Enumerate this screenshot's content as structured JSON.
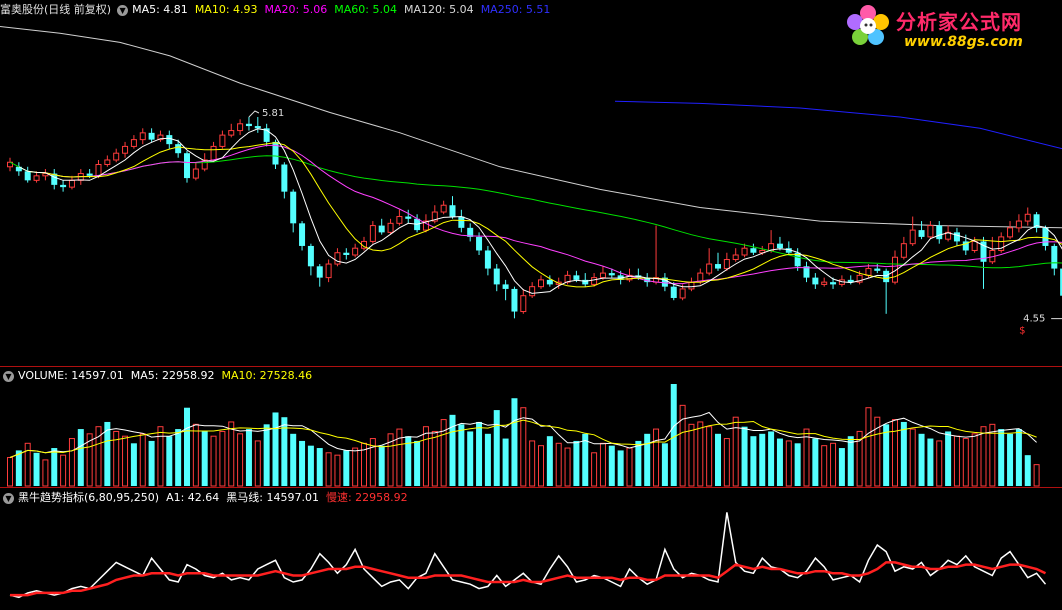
{
  "main_legend": {
    "title": "富奥股份(日线 前复权)",
    "items": [
      {
        "text": "MA5: 4.81",
        "color": "#ffffff"
      },
      {
        "text": "MA10: 4.93",
        "color": "#ffff00"
      },
      {
        "text": "MA20: 5.06",
        "color": "#ff00ff"
      },
      {
        "text": "MA60: 5.04",
        "color": "#00ff00"
      },
      {
        "text": "MA120: 5.04",
        "color": "#d8d8d8"
      },
      {
        "text": "MA250: 5.51",
        "color": "#3030ff"
      }
    ]
  },
  "vol_legend": {
    "items": [
      {
        "text": "VOLUME: 14597.01",
        "color": "#ffffff"
      },
      {
        "text": "MA5: 22958.92",
        "color": "#ffffff"
      },
      {
        "text": "MA10: 27528.46",
        "color": "#ffff00"
      }
    ]
  },
  "ind_legend": {
    "items": [
      {
        "text": "黑牛趋势指标(6,80,95,250)",
        "color": "#ffffff"
      },
      {
        "text": "A1: 42.64",
        "color": "#ffffff"
      },
      {
        "text": "黑马线: 14597.01",
        "color": "#ffffff"
      },
      {
        "text": "慢速: 22958.92",
        "color": "#ff3030"
      }
    ]
  },
  "logo": {
    "line1": "分析家公式网",
    "line2": "www.88gs.com"
  },
  "chart_data": {
    "type": "candlestick",
    "price_range": [
      4.5,
      5.95
    ],
    "high_annotation": "5.81",
    "low_annotation": "4.55",
    "marker": "$",
    "colors": {
      "up": "#ff3c3c",
      "down": "#54ffff",
      "ma5": "#ffffff",
      "ma10": "#ffff00",
      "ma20": "#ff40ff",
      "ma60": "#00e000",
      "ma120": "#d0d0d0",
      "ma250": "#2020ff",
      "slow": "#ff2020"
    },
    "candles": [
      [
        5.31,
        5.33,
        5.29,
        5.35
      ],
      [
        5.31,
        5.29,
        5.27,
        5.33
      ],
      [
        5.29,
        5.25,
        5.24,
        5.31
      ],
      [
        5.25,
        5.27,
        5.24,
        5.29
      ],
      [
        5.27,
        5.28,
        5.25,
        5.3
      ],
      [
        5.28,
        5.23,
        5.21,
        5.3
      ],
      [
        5.23,
        5.22,
        5.2,
        5.25
      ],
      [
        5.22,
        5.25,
        5.21,
        5.27
      ],
      [
        5.25,
        5.28,
        5.23,
        5.3
      ],
      [
        5.28,
        5.27,
        5.26,
        5.3
      ],
      [
        5.27,
        5.32,
        5.26,
        5.34
      ],
      [
        5.32,
        5.34,
        5.31,
        5.36
      ],
      [
        5.34,
        5.37,
        5.33,
        5.39
      ],
      [
        5.37,
        5.4,
        5.35,
        5.42
      ],
      [
        5.4,
        5.43,
        5.39,
        5.45
      ],
      [
        5.43,
        5.46,
        5.41,
        5.48
      ],
      [
        5.46,
        5.43,
        5.42,
        5.48
      ],
      [
        5.43,
        5.45,
        5.42,
        5.47
      ],
      [
        5.45,
        5.41,
        5.39,
        5.47
      ],
      [
        5.41,
        5.37,
        5.35,
        5.43
      ],
      [
        5.37,
        5.26,
        5.24,
        5.38
      ],
      [
        5.26,
        5.3,
        5.25,
        5.33
      ],
      [
        5.3,
        5.34,
        5.29,
        5.37
      ],
      [
        5.34,
        5.4,
        5.33,
        5.42
      ],
      [
        5.4,
        5.45,
        5.39,
        5.47
      ],
      [
        5.45,
        5.47,
        5.44,
        5.5
      ],
      [
        5.47,
        5.5,
        5.45,
        5.52
      ],
      [
        5.5,
        5.49,
        5.47,
        5.53
      ],
      [
        5.49,
        5.48,
        5.46,
        5.53
      ],
      [
        5.48,
        5.42,
        5.4,
        5.5
      ],
      [
        5.42,
        5.32,
        5.3,
        5.43
      ],
      [
        5.32,
        5.2,
        5.17,
        5.33
      ],
      [
        5.2,
        5.06,
        5.02,
        5.21
      ],
      [
        5.06,
        4.96,
        4.94,
        5.07
      ],
      [
        4.96,
        4.87,
        4.83,
        4.97
      ],
      [
        4.87,
        4.82,
        4.78,
        4.88
      ],
      [
        4.82,
        4.88,
        4.8,
        4.9
      ],
      [
        4.88,
        4.93,
        4.87,
        4.95
      ],
      [
        4.93,
        4.92,
        4.9,
        4.95
      ],
      [
        4.92,
        4.95,
        4.91,
        4.97
      ],
      [
        4.95,
        4.98,
        4.94,
        5.0
      ],
      [
        4.98,
        5.05,
        4.97,
        5.07
      ],
      [
        5.05,
        5.02,
        5.01,
        5.08
      ],
      [
        5.02,
        5.06,
        5.01,
        5.08
      ],
      [
        5.06,
        5.09,
        5.05,
        5.12
      ],
      [
        5.09,
        5.08,
        5.06,
        5.12
      ],
      [
        5.08,
        5.03,
        5.02,
        5.1
      ],
      [
        5.03,
        5.07,
        5.02,
        5.1
      ],
      [
        5.07,
        5.11,
        5.06,
        5.14
      ],
      [
        5.11,
        5.14,
        5.1,
        5.16
      ],
      [
        5.14,
        5.09,
        5.08,
        5.18
      ],
      [
        5.09,
        5.04,
        5.02,
        5.12
      ],
      [
        5.04,
        5.0,
        4.98,
        5.06
      ],
      [
        5.0,
        4.94,
        4.92,
        5.02
      ],
      [
        4.94,
        4.86,
        4.83,
        4.96
      ],
      [
        4.86,
        4.79,
        4.76,
        4.88
      ],
      [
        4.79,
        4.77,
        4.72,
        4.81
      ],
      [
        4.77,
        4.67,
        4.64,
        4.78
      ],
      [
        4.67,
        4.74,
        4.66,
        4.77
      ],
      [
        4.74,
        4.78,
        4.73,
        4.8
      ],
      [
        4.78,
        4.81,
        4.77,
        4.83
      ],
      [
        4.81,
        4.79,
        4.78,
        4.83
      ],
      [
        4.79,
        4.8,
        4.77,
        4.82
      ],
      [
        4.8,
        4.83,
        4.79,
        4.85
      ],
      [
        4.83,
        4.81,
        4.8,
        4.85
      ],
      [
        4.81,
        4.79,
        4.78,
        4.84
      ],
      [
        4.79,
        4.82,
        4.78,
        4.84
      ],
      [
        4.82,
        4.84,
        4.81,
        4.87
      ],
      [
        4.84,
        4.83,
        4.82,
        4.86
      ],
      [
        4.83,
        4.81,
        4.79,
        4.85
      ],
      [
        4.81,
        4.83,
        4.8,
        4.86
      ],
      [
        4.83,
        4.82,
        4.81,
        4.86
      ],
      [
        4.82,
        4.8,
        4.78,
        4.84
      ],
      [
        4.8,
        4.82,
        4.79,
        5.05
      ],
      [
        4.82,
        4.78,
        4.76,
        4.84
      ],
      [
        4.78,
        4.73,
        4.72,
        4.8
      ],
      [
        4.73,
        4.77,
        4.72,
        4.79
      ],
      [
        4.77,
        4.8,
        4.76,
        4.82
      ],
      [
        4.8,
        4.84,
        4.79,
        4.86
      ],
      [
        4.84,
        4.88,
        4.83,
        4.95
      ],
      [
        4.88,
        4.86,
        4.85,
        4.93
      ],
      [
        4.86,
        4.9,
        4.85,
        4.93
      ],
      [
        4.9,
        4.92,
        4.89,
        4.95
      ],
      [
        4.92,
        4.95,
        4.91,
        4.97
      ],
      [
        4.95,
        4.93,
        4.92,
        4.97
      ],
      [
        4.93,
        4.94,
        4.92,
        4.96
      ],
      [
        4.94,
        4.97,
        4.93,
        5.03
      ],
      [
        4.97,
        4.95,
        4.94,
        5.0
      ],
      [
        4.95,
        4.93,
        4.92,
        4.98
      ],
      [
        4.93,
        4.87,
        4.85,
        4.95
      ],
      [
        4.87,
        4.82,
        4.8,
        4.89
      ],
      [
        4.82,
        4.79,
        4.77,
        4.84
      ],
      [
        4.79,
        4.8,
        4.78,
        4.82
      ],
      [
        4.8,
        4.79,
        4.77,
        4.82
      ],
      [
        4.79,
        4.81,
        4.78,
        4.83
      ],
      [
        4.81,
        4.8,
        4.79,
        4.83
      ],
      [
        4.8,
        4.83,
        4.79,
        4.85
      ],
      [
        4.83,
        4.86,
        4.82,
        4.88
      ],
      [
        4.86,
        4.85,
        4.84,
        4.88
      ],
      [
        4.85,
        4.8,
        4.66,
        4.86
      ],
      [
        4.8,
        4.91,
        4.79,
        4.94
      ],
      [
        4.91,
        4.97,
        4.9,
        5.0
      ],
      [
        4.97,
        5.03,
        4.96,
        5.09
      ],
      [
        5.03,
        5.0,
        4.99,
        5.07
      ],
      [
        5.0,
        5.05,
        4.99,
        5.07
      ],
      [
        5.05,
        4.99,
        4.97,
        5.07
      ],
      [
        4.99,
        5.02,
        4.98,
        5.05
      ],
      [
        5.02,
        4.98,
        4.96,
        5.04
      ],
      [
        4.98,
        4.94,
        4.92,
        5.01
      ],
      [
        4.94,
        4.98,
        4.93,
        5.0
      ],
      [
        4.98,
        4.89,
        4.77,
        5.0
      ],
      [
        4.89,
        4.94,
        4.88,
        5.0
      ],
      [
        4.94,
        5.0,
        4.93,
        5.02
      ],
      [
        5.0,
        5.04,
        4.99,
        5.07
      ],
      [
        5.04,
        5.07,
        5.02,
        5.1
      ],
      [
        5.07,
        5.1,
        5.05,
        5.13
      ],
      [
        5.1,
        5.04,
        5.02,
        5.11
      ],
      [
        5.04,
        4.96,
        4.94,
        5.05
      ],
      [
        4.96,
        4.86,
        4.83,
        4.97
      ],
      [
        4.86,
        4.74,
        4.63,
        4.87
      ],
      [
        4.74,
        4.82,
        4.73,
        4.84
      ]
    ],
    "ma120_line": [
      [
        0,
        5.93
      ],
      [
        60,
        5.9
      ],
      [
        120,
        5.86
      ],
      [
        170,
        5.8
      ],
      [
        240,
        5.68
      ],
      [
        330,
        5.55
      ],
      [
        400,
        5.46
      ],
      [
        500,
        5.31
      ],
      [
        600,
        5.21
      ],
      [
        700,
        5.13
      ],
      [
        820,
        5.07
      ],
      [
        940,
        5.05
      ],
      [
        1062,
        5.04
      ]
    ],
    "ma250_line": [
      [
        615,
        5.6
      ],
      [
        700,
        5.59
      ],
      [
        800,
        5.57
      ],
      [
        900,
        5.53
      ],
      [
        980,
        5.48
      ],
      [
        1062,
        5.39
      ]
    ],
    "volume": [
      [
        12,
        1
      ],
      [
        15,
        0
      ],
      [
        18,
        1
      ],
      [
        14,
        0
      ],
      [
        11,
        1
      ],
      [
        16,
        0
      ],
      [
        13,
        1
      ],
      [
        20,
        1
      ],
      [
        24,
        0
      ],
      [
        22,
        1
      ],
      [
        25,
        1
      ],
      [
        27,
        0
      ],
      [
        23,
        1
      ],
      [
        21,
        1
      ],
      [
        18,
        0
      ],
      [
        22,
        1
      ],
      [
        19,
        0
      ],
      [
        25,
        1
      ],
      [
        21,
        0
      ],
      [
        24,
        0
      ],
      [
        33,
        0
      ],
      [
        26,
        1
      ],
      [
        23,
        0
      ],
      [
        21,
        1
      ],
      [
        23,
        1
      ],
      [
        27,
        1
      ],
      [
        22,
        1
      ],
      [
        24,
        0
      ],
      [
        19,
        1
      ],
      [
        26,
        0
      ],
      [
        31,
        0
      ],
      [
        29,
        0
      ],
      [
        22,
        0
      ],
      [
        19,
        0
      ],
      [
        17,
        0
      ],
      [
        16,
        0
      ],
      [
        14,
        1
      ],
      [
        13,
        1
      ],
      [
        15,
        0
      ],
      [
        16,
        1
      ],
      [
        18,
        1
      ],
      [
        20,
        1
      ],
      [
        17,
        0
      ],
      [
        22,
        1
      ],
      [
        24,
        1
      ],
      [
        21,
        0
      ],
      [
        19,
        0
      ],
      [
        25,
        1
      ],
      [
        23,
        1
      ],
      [
        28,
        1
      ],
      [
        30,
        0
      ],
      [
        26,
        0
      ],
      [
        23,
        0
      ],
      [
        27,
        0
      ],
      [
        22,
        0
      ],
      [
        32,
        0
      ],
      [
        20,
        0
      ],
      [
        37,
        0
      ],
      [
        33,
        1
      ],
      [
        19,
        1
      ],
      [
        17,
        1
      ],
      [
        21,
        0
      ],
      [
        18,
        1
      ],
      [
        16,
        1
      ],
      [
        19,
        0
      ],
      [
        22,
        0
      ],
      [
        14,
        1
      ],
      [
        18,
        1
      ],
      [
        17,
        0
      ],
      [
        15,
        0
      ],
      [
        16,
        1
      ],
      [
        19,
        0
      ],
      [
        22,
        0
      ],
      [
        24,
        1
      ],
      [
        18,
        0
      ],
      [
        43,
        0
      ],
      [
        34,
        1
      ],
      [
        26,
        1
      ],
      [
        27,
        1
      ],
      [
        25,
        1
      ],
      [
        22,
        0
      ],
      [
        20,
        1
      ],
      [
        29,
        1
      ],
      [
        25,
        0
      ],
      [
        21,
        0
      ],
      [
        22,
        0
      ],
      [
        23,
        0
      ],
      [
        20,
        0
      ],
      [
        19,
        1
      ],
      [
        18,
        0
      ],
      [
        24,
        1
      ],
      [
        20,
        0
      ],
      [
        17,
        1
      ],
      [
        18,
        1
      ],
      [
        16,
        0
      ],
      [
        21,
        0
      ],
      [
        23,
        1
      ],
      [
        33,
        1
      ],
      [
        29,
        1
      ],
      [
        26,
        0
      ],
      [
        28,
        1
      ],
      [
        27,
        0
      ],
      [
        24,
        1
      ],
      [
        22,
        0
      ],
      [
        20,
        0
      ],
      [
        19,
        1
      ],
      [
        23,
        0
      ],
      [
        21,
        1
      ],
      [
        20,
        1
      ],
      [
        22,
        1
      ],
      [
        25,
        1
      ],
      [
        26,
        1
      ],
      [
        24,
        0
      ],
      [
        22,
        0
      ],
      [
        24,
        0
      ],
      [
        13,
        0
      ],
      [
        9,
        1
      ]
    ],
    "vol_max": 43,
    "ind_white": [
      5,
      4,
      6,
      7,
      6,
      5,
      6,
      8,
      9,
      8,
      12,
      16,
      20,
      18,
      16,
      14,
      22,
      17,
      12,
      11,
      19,
      17,
      14,
      13,
      15,
      12,
      13,
      12,
      17,
      19,
      21,
      13,
      11,
      12,
      17,
      24,
      20,
      15,
      19,
      26,
      17,
      13,
      9,
      11,
      12,
      8,
      13,
      15,
      24,
      18,
      12,
      11,
      10,
      8,
      9,
      14,
      9,
      12,
      15,
      11,
      10,
      17,
      23,
      18,
      11,
      12,
      14,
      13,
      11,
      9,
      17,
      13,
      10,
      12,
      26,
      17,
      13,
      15,
      14,
      12,
      11,
      43,
      20,
      16,
      15,
      22,
      18,
      17,
      14,
      13,
      16,
      22,
      18,
      12,
      13,
      14,
      11,
      21,
      28,
      25,
      16,
      18,
      17,
      20,
      14,
      17,
      21,
      19,
      23,
      18,
      16,
      14,
      22,
      25,
      19,
      13,
      15,
      10
    ],
    "ind_red": [
      5,
      5,
      5,
      6,
      6,
      6,
      6,
      7,
      7,
      8,
      9,
      10,
      12,
      13,
      14,
      14,
      15,
      15,
      15,
      14,
      15,
      15,
      15,
      14,
      14,
      14,
      14,
      14,
      14,
      15,
      16,
      15,
      14,
      14,
      15,
      16,
      17,
      17,
      17,
      18,
      18,
      17,
      16,
      15,
      14,
      13,
      13,
      13,
      14,
      14,
      14,
      14,
      13,
      12,
      11,
      11,
      11,
      11,
      12,
      11,
      11,
      12,
      13,
      14,
      13,
      13,
      13,
      13,
      13,
      12,
      13,
      13,
      12,
      12,
      14,
      14,
      14,
      14,
      14,
      14,
      13,
      16,
      19,
      18,
      17,
      18,
      17,
      17,
      16,
      15,
      15,
      16,
      16,
      15,
      15,
      14,
      14,
      15,
      17,
      20,
      20,
      19,
      18,
      18,
      17,
      17,
      18,
      18,
      19,
      19,
      18,
      17,
      18,
      19,
      19,
      18,
      17,
      15
    ],
    "ind_max": 45
  }
}
